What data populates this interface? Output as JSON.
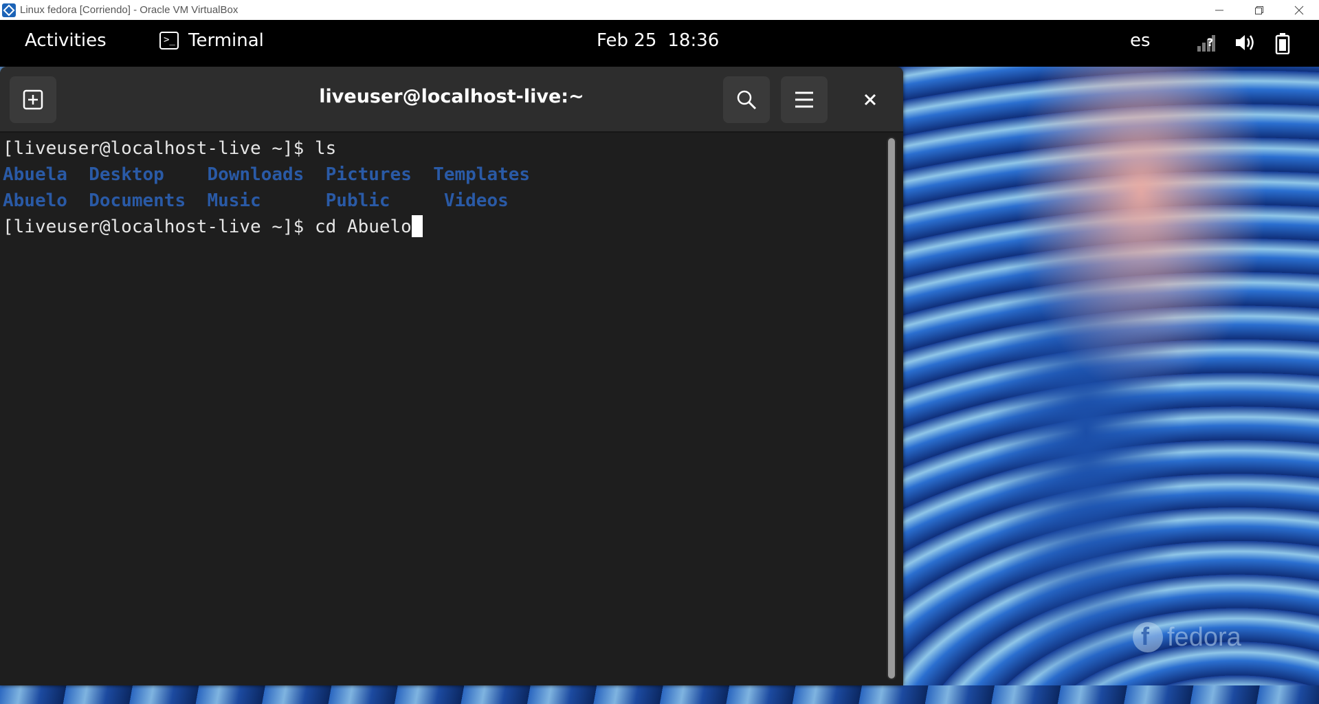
{
  "host_window": {
    "title": "Linux fedora [Corriendo] - Oracle VM VirtualBox",
    "icon": "virtualbox-icon",
    "controls": [
      "minimize-icon",
      "restore-icon",
      "close-icon"
    ]
  },
  "topbar": {
    "activities_label": "Activities",
    "app_name": "Terminal",
    "date": "Feb 25",
    "time": "18:36",
    "keyboard_layout": "es",
    "tray_icons": [
      "network-question-icon",
      "volume-icon",
      "battery-icon"
    ]
  },
  "terminal": {
    "title": "liveuser@localhost-live:~",
    "prompt": "[liveuser@localhost-live ~]$",
    "command1": " ls",
    "ls_row1": [
      "Abuela",
      "Desktop",
      "Downloads",
      "Pictures",
      "Templates"
    ],
    "ls_row2": [
      "Abuelo",
      "Documents",
      "Music",
      "Public",
      "Videos"
    ],
    "command2": " cd Abuelo",
    "directory_color": "#2a5aa6"
  },
  "desktop": {
    "watermark": "fedora"
  }
}
